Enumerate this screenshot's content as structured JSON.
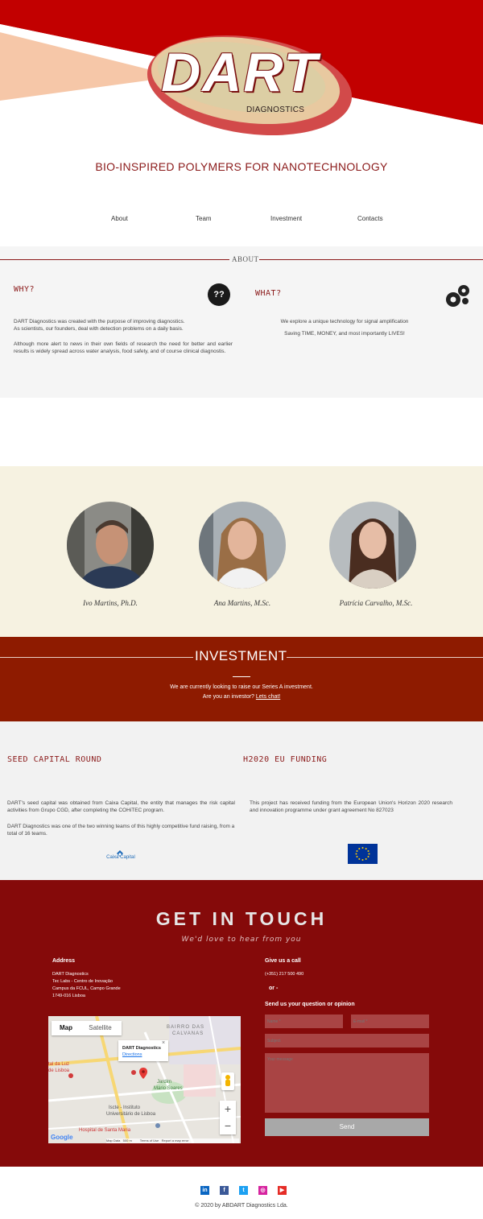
{
  "brand": {
    "logo_main": "DART",
    "logo_sub": "DIAGNOSTICS",
    "tagline": "BIO-INSPIRED POLYMERS FOR NANOTECHNOLOGY"
  },
  "nav": {
    "items": [
      {
        "label": "About"
      },
      {
        "label": "Team"
      },
      {
        "label": "Investment"
      },
      {
        "label": "Contacts"
      }
    ]
  },
  "about": {
    "title": "ABOUT",
    "why": {
      "heading": "WHY?",
      "icon": "question-icon",
      "p1": "DART Diagnostics was created with the purpose of improving diagnostics.",
      "p2": "As scientists, our founders, deal with detection problems on a daily basis.",
      "p3": "Although more alert to news in their own fields of research the need for better and earlier results is widely spread across water analysis, food safety, and of course clinical diagnostis."
    },
    "what": {
      "heading": "WHAT?",
      "icon": "gears-icon",
      "p1": "We explore a unique technology for signal amplification",
      "p2": "Saving TIME, MONEY, and most importantly LIVES!"
    }
  },
  "team": {
    "members": [
      {
        "name": "Ivo Martins, Ph.D."
      },
      {
        "name": "Ana Martins, M.Sc."
      },
      {
        "name": "Patrícia Carvalho, M.Sc."
      }
    ]
  },
  "investment": {
    "title": "INVESTMENT",
    "line1": "We are currently looking to raise our Series A investment.",
    "line2_prefix": "Are you an investor?",
    "line2_link": "Lets chat!"
  },
  "funding": {
    "seed": {
      "heading": "SEED CAPITAL ROUND",
      "p1": "DART's seed capital was obtained from Caixa Capital, the entity that manages the risk capital activities from Grupo CGD, after completing the COHiTEC program.",
      "p2": "DART Diagnostics was one of the two winning teams of this highly competitive fund raising, from a total of 16 teams.",
      "logo_text": "Caixa Capital"
    },
    "h2020": {
      "heading": "H2020 EU FUNDING",
      "p1": "This project has received funding from the European Union's Horizon 2020 research and innovation programme under grant agreement No 827023"
    }
  },
  "contact": {
    "title": "GET IN TOUCH",
    "subtitle": "We'd love to hear from you",
    "address_label": "Address",
    "address_lines": [
      "DART Diagnostics",
      "Tec Labs  - Centro de Inovação",
      "Campus da FCUL, Campo Grande",
      "1749-016 Lisboa"
    ],
    "call_label": "Give us a call",
    "phone": "(+351) 217 500 490",
    "or_text": "or -",
    "send_label": "Send us your question or opinion",
    "form": {
      "name_placeholder": "Name *",
      "email_placeholder": "E-mail *",
      "subject_placeholder": "Subject",
      "message_placeholder": "Your message",
      "send_button": "Send"
    },
    "map": {
      "tab_map": "Map",
      "tab_satellite": "Satellite",
      "popup_title": "DART Diagnostics",
      "popup_link": "Directions",
      "label_jardim": "Jardim",
      "label_mario": "Mário Soares",
      "label_bairro": "BAIRRO DAS",
      "label_calvanas": "CALVANAS",
      "label_liceu": "Iscte - Instituto",
      "label_univ": "Universitário de Lisboa",
      "label_hospital": "Hospital de Santa Maria",
      "label_luz": "tal da Luz",
      "label_lisboa": "de Lisboa",
      "label_google": "Google",
      "footer_text": "Map Data   500 m         Terms of Use   Report a map error",
      "zoom_in": "+",
      "zoom_out": "−"
    }
  },
  "footer": {
    "social": [
      {
        "name": "linkedin-icon",
        "glyph": "in",
        "color": "#0a66c2"
      },
      {
        "name": "facebook-icon",
        "glyph": "f",
        "color": "#3b5998"
      },
      {
        "name": "twitter-icon",
        "glyph": "t",
        "color": "#1da1f2"
      },
      {
        "name": "instagram-icon",
        "glyph": "◎",
        "color": "#d6249f"
      },
      {
        "name": "youtube-icon",
        "glyph": "▶",
        "color": "#e52d27"
      }
    ],
    "copyright": "© 2020 by ABDART Diagnostics Lda."
  },
  "colors": {
    "brand_red": "#c00000",
    "investment_bg": "#8e1b00",
    "contact_bg": "#850a0a",
    "team_bg": "#f6f2e1"
  }
}
